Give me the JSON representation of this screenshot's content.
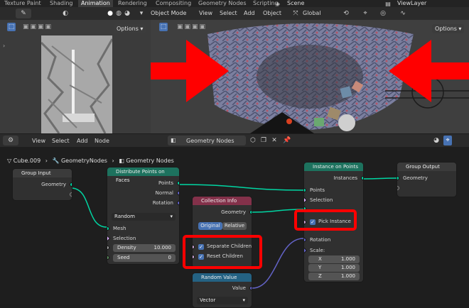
{
  "workspace_tabs": [
    "Texture Paint",
    "Shading",
    "Animation",
    "Rendering",
    "Compositing",
    "Geometry Nodes",
    "Scripting"
  ],
  "scene_label": "Scene",
  "view_layer_label": "ViewLayer",
  "left_view": {
    "options_label": "Options"
  },
  "right_view": {
    "mode_label": "Object Mode",
    "menu": [
      "View",
      "Select",
      "Add",
      "Object"
    ],
    "orientation_label": "Global",
    "options_label": "Options"
  },
  "node_editor": {
    "menu": [
      "View",
      "Select",
      "Add",
      "Node"
    ],
    "tree_name": "Geometry Nodes"
  },
  "breadcrumb": [
    "Cube.009",
    "GeometryNodes",
    "Geometry Nodes"
  ],
  "nodes": {
    "group_input": {
      "title": "Group Input",
      "output": "Geometry"
    },
    "distribute": {
      "title": "Distribute Points on Faces",
      "outputs": [
        "Points",
        "Normal",
        "Rotation"
      ],
      "mode": "Random",
      "inputs": [
        "Mesh",
        "Selection"
      ],
      "density_label": "Density",
      "density_value": "10.000",
      "seed_label": "Seed",
      "seed_value": "0"
    },
    "collection_info": {
      "title": "Collection Info",
      "output": "Geometry",
      "tab_original": "Original",
      "tab_relative": "Relative",
      "separate_children": "Separate Children",
      "reset_children": "Reset Children"
    },
    "random_value": {
      "title": "Random Value",
      "output": "Value",
      "type": "Vector"
    },
    "instance_on_points": {
      "title": "Instance on Points",
      "output": "Instances",
      "points": "Points",
      "selection": "Selection",
      "pick_instance": "Pick Instance",
      "rotation": "Rotation",
      "scale": "Scale:",
      "x_label": "X",
      "x_value": "1.000",
      "y_label": "Y",
      "y_value": "1.000",
      "z_label": "Z",
      "z_value": "1.000"
    },
    "group_output": {
      "title": "Group Output",
      "input": "Geometry"
    }
  },
  "colors": {
    "geometry_socket": "#00d6a3",
    "float_socket": "#a1a1a1",
    "vector_socket": "#6363c7",
    "node_header_green": "#1d725e",
    "node_header_red": "#83314a",
    "node_header_blue": "#246283",
    "highlight": "#ff0000"
  }
}
